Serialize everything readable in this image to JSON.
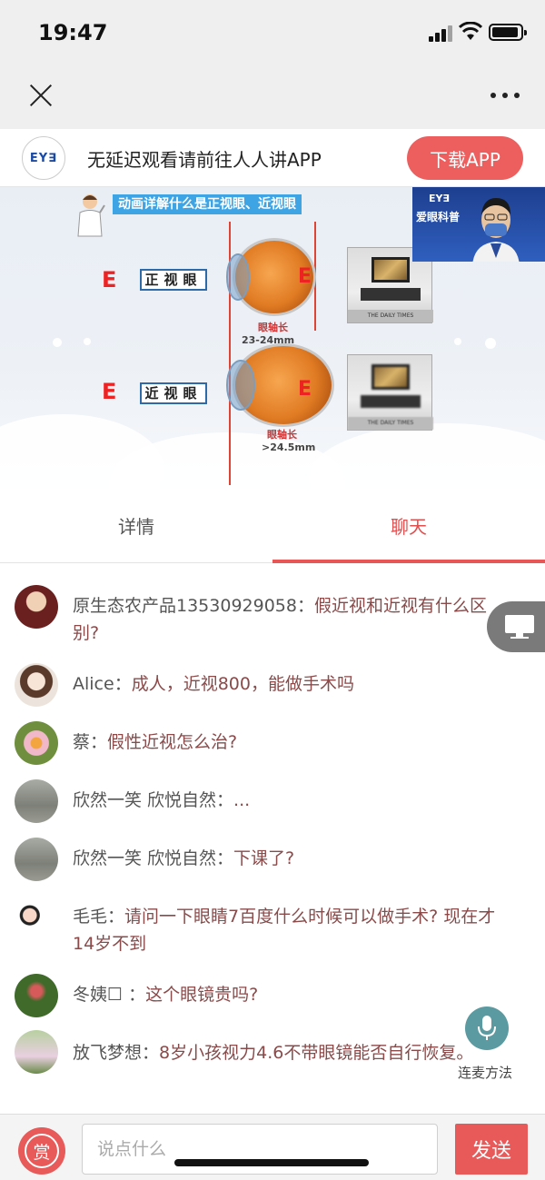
{
  "status_bar": {
    "time": "19:47"
  },
  "banner": {
    "logo_text": "EY∃",
    "title": "无延迟观看请前往人人讲APP",
    "download_label": "下载APP"
  },
  "video": {
    "slide_title": "动画详解什么是正视眼、近视眼",
    "letter": "E",
    "normal_label": "正视眼",
    "myopia_label": "近视眼",
    "axis_label": "眼轴长",
    "normal_axis": "23-24mm",
    "myopia_axis": ">24.5mm",
    "tv_caption": "THE DAILY TIMES",
    "pip_brand": "EY∃",
    "pip_title": "爱眼科普"
  },
  "tabs": {
    "details": "详情",
    "chat": "聊天"
  },
  "chat": [
    {
      "name": "原生态农产品13530929058：",
      "text": "假近视和近视有什么区别?",
      "avatar_color": "#8b2e2e"
    },
    {
      "name": "Alice：",
      "text": "成人，近视800，能做手术吗",
      "avatar_color": "#c9b9a8"
    },
    {
      "name": "蔡：",
      "text": "假性近视怎么治?",
      "avatar_color": "#7a8c52"
    },
    {
      "name": "欣然一笑 欣悦自然：",
      "text": "...",
      "avatar_color": "#8d8f88"
    },
    {
      "name": "欣然一笑 欣悦自然：",
      "text": "下课了?",
      "avatar_color": "#8d8f88"
    },
    {
      "name": "毛毛：",
      "text": "请问一下眼睛7百度什么时候可以做手术? 现在才14岁不到",
      "avatar_color": "#e8d8d8"
    },
    {
      "name": "冬姨☐ ：",
      "text": "这个眼镜贵吗?",
      "avatar_color": "#5a6b3a"
    },
    {
      "name": "放飞梦想：",
      "text": "8岁小孩视力4.6不带眼镜能否自行恢复。",
      "avatar_color": "#9aa77a"
    }
  ],
  "mic_label": "连麦方法",
  "bottom": {
    "reward_label": "赏",
    "input_placeholder": "说点什么",
    "send_label": "发送"
  }
}
